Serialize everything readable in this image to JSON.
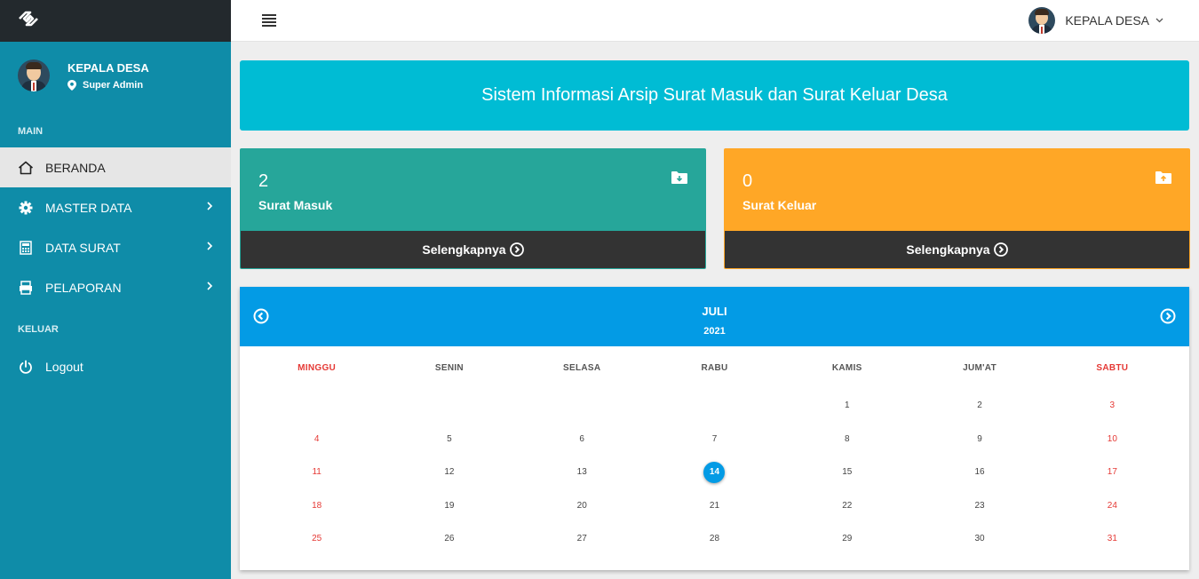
{
  "sidebar": {
    "user_name": "KEPALA DESA",
    "user_role": "Super Admin",
    "section_main": "MAIN",
    "items": [
      {
        "label": "BERANDA"
      },
      {
        "label": "MASTER DATA"
      },
      {
        "label": "DATA SURAT"
      },
      {
        "label": "PELAPORAN"
      }
    ],
    "section_out": "KELUAR",
    "logout_label": "Logout"
  },
  "header": {
    "user_name": "KEPALA DESA"
  },
  "banner": {
    "title": "Sistem Informasi Arsip Surat Masuk dan Surat Keluar Desa"
  },
  "stats": {
    "masuk": {
      "count": "2",
      "label": "Surat Masuk",
      "more": "Selengkapnya"
    },
    "keluar": {
      "count": "0",
      "label": "Surat Keluar",
      "more": "Selengkapnya"
    }
  },
  "calendar": {
    "month": "JULI",
    "year": "2021",
    "days": [
      "MINGGU",
      "SENIN",
      "SELASA",
      "RABU",
      "KAMIS",
      "JUM'AT",
      "SABTU"
    ],
    "today": "14",
    "weeks": [
      [
        "",
        "",
        "",
        "",
        "1",
        "2",
        "3"
      ],
      [
        "4",
        "5",
        "6",
        "7",
        "8",
        "9",
        "10"
      ],
      [
        "11",
        "12",
        "13",
        "14",
        "15",
        "16",
        "17"
      ],
      [
        "18",
        "19",
        "20",
        "21",
        "22",
        "23",
        "24"
      ],
      [
        "25",
        "26",
        "27",
        "28",
        "29",
        "30",
        "31"
      ]
    ]
  },
  "colors": {
    "sidebar": "#0f8ca8",
    "brand_bar": "#23292d",
    "banner": "#00bcd4",
    "masuk": "#26a69a",
    "keluar": "#ffa726",
    "calendar_header": "#039be5",
    "weekend": "#e53935"
  }
}
